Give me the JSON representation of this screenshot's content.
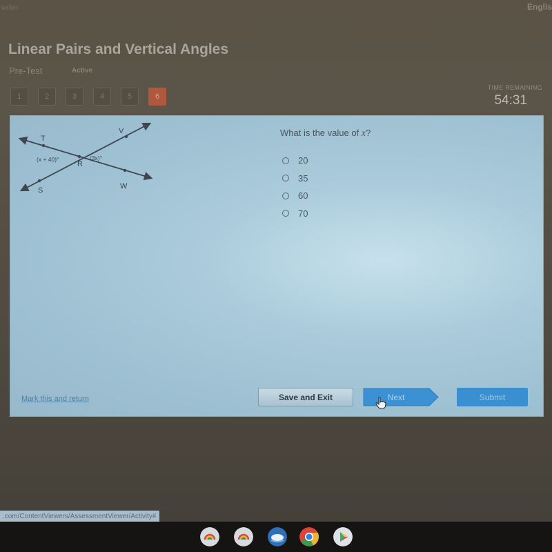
{
  "top_bar": {
    "brand_fragment": "writer",
    "language": "Englis"
  },
  "header": {
    "title": "Linear Pairs and Vertical Angles",
    "subtitle": "Pre-Test",
    "status": "Active"
  },
  "question_nav": {
    "items": [
      {
        "label": "1",
        "active": false
      },
      {
        "label": "2",
        "active": false
      },
      {
        "label": "3",
        "active": false
      },
      {
        "label": "4",
        "active": false
      },
      {
        "label": "5",
        "active": false
      },
      {
        "label": "6",
        "active": true
      }
    ]
  },
  "timer": {
    "label": "TIME REMAINING",
    "value": "54:31"
  },
  "diagram": {
    "points": [
      "T",
      "V",
      "R",
      "S",
      "W"
    ],
    "angle_left": "(x + 40)°",
    "angle_right": "(3x)°"
  },
  "question": {
    "prefix": "What is the value of ",
    "variable": "x",
    "suffix": "?",
    "options": [
      {
        "label": "20",
        "selected": false
      },
      {
        "label": "35",
        "selected": false
      },
      {
        "label": "60",
        "selected": false
      },
      {
        "label": "70",
        "selected": false
      }
    ]
  },
  "footer": {
    "mark_link": "Mark this and return",
    "save_exit": "Save and Exit",
    "next": "Next",
    "submit": "Submit"
  },
  "status_url": ".com/ContentViewers/AssessmentViewer/Activity#",
  "shelf_apps": [
    "rainbow-app-icon",
    "rainbow-app-icon",
    "ocean-app-icon",
    "chrome-icon",
    "play-store-icon"
  ],
  "colors": {
    "active_question": "#b0583d",
    "primary_button": "#3a8fd0",
    "card_background": "#aacbdb"
  }
}
